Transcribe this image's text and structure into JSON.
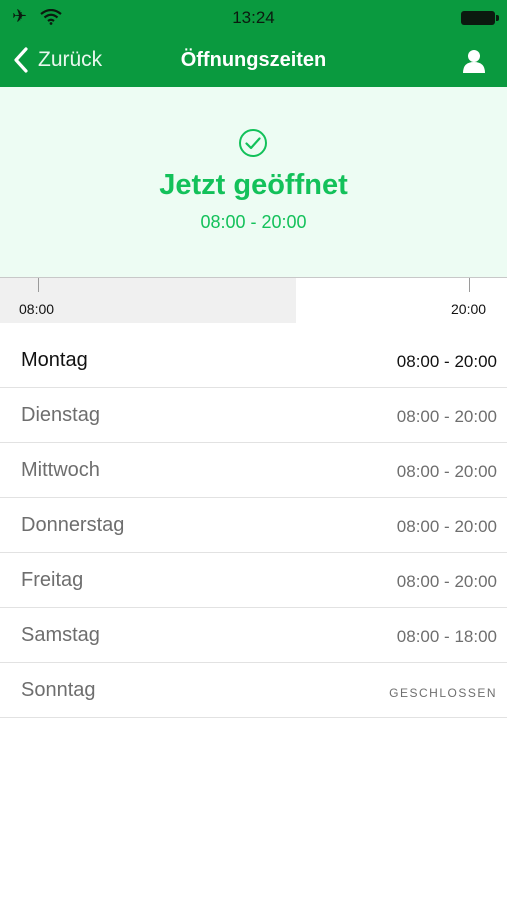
{
  "status_bar": {
    "time": "13:24",
    "plane_icon": "airplane-icon",
    "wifi_icon": "wifi-icon",
    "battery_icon": "battery-icon"
  },
  "nav": {
    "back_label": "Zurück",
    "title": "Öffnungszeiten",
    "user_icon": "user-icon"
  },
  "hero": {
    "status": "Jetzt geöffnet",
    "hours": "08:00 - 20:00",
    "icon": "check-circle-icon"
  },
  "timeline": {
    "start": "08:00",
    "end": "20:00"
  },
  "days": [
    {
      "day": "Montag",
      "hours": "08:00 - 20:00"
    },
    {
      "day": "Dienstag",
      "hours": "08:00 - 20:00"
    },
    {
      "day": "Mittwoch",
      "hours": "08:00 - 20:00"
    },
    {
      "day": "Donnerstag",
      "hours": "08:00 - 20:00"
    },
    {
      "day": "Freitag",
      "hours": "08:00 - 20:00"
    },
    {
      "day": "Samstag",
      "hours": "08:00 - 18:00"
    },
    {
      "day": "Sonntag",
      "hours": "GESCHLOSSEN"
    }
  ],
  "colors": {
    "nav_green": "#0a9a3f",
    "accent_green": "#13c15a",
    "hero_bg": "#edfcf3"
  }
}
